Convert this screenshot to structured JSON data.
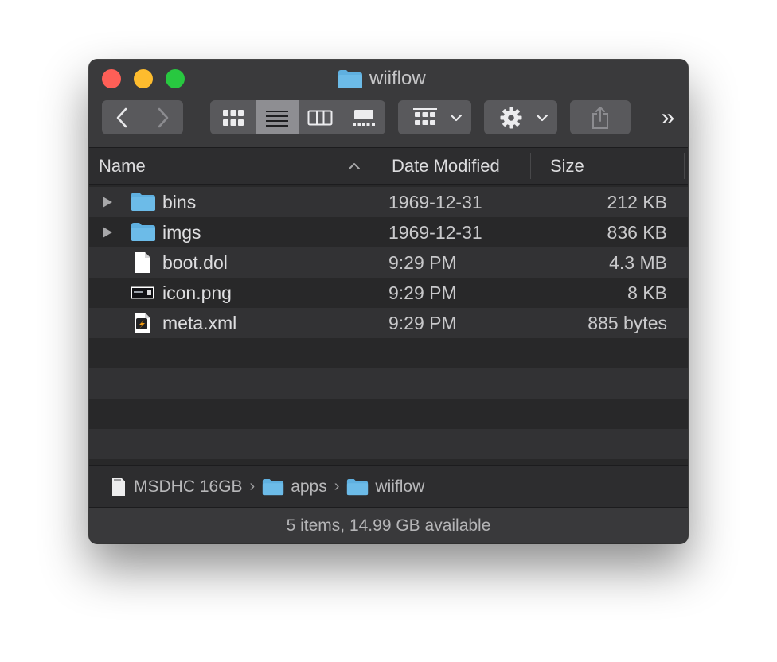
{
  "window": {
    "title": "wiiflow"
  },
  "toolbar": {
    "back": "back-chevron",
    "forward": "forward-chevron",
    "view_modes": [
      "icon-view",
      "list-view",
      "column-view",
      "gallery-view"
    ],
    "active_view": "list-view",
    "group_menu": "group-by-icon",
    "action_menu": "gear-icon",
    "share": "share-icon",
    "overflow": "»"
  },
  "columns": {
    "name": "Name",
    "date": "Date Modified",
    "size": "Size",
    "sort_indicator": "˄"
  },
  "files": [
    {
      "name": "bins",
      "date": "1969-12-31",
      "size": "212 KB",
      "kind": "folder"
    },
    {
      "name": "imgs",
      "date": "1969-12-31",
      "size": "836 KB",
      "kind": "folder"
    },
    {
      "name": "boot.dol",
      "date": "9:29 PM",
      "size": "4.3 MB",
      "kind": "document"
    },
    {
      "name": "icon.png",
      "date": "9:29 PM",
      "size": "8 KB",
      "kind": "image"
    },
    {
      "name": "meta.xml",
      "date": "9:29 PM",
      "size": "885 bytes",
      "kind": "xml"
    }
  ],
  "path": [
    {
      "label": "MSDHC 16GB",
      "icon": "sd-card-icon"
    },
    {
      "label": "apps",
      "icon": "folder-icon"
    },
    {
      "label": "wiiflow",
      "icon": "folder-icon"
    }
  ],
  "path_separator": "›",
  "status": "5 items, 14.99 GB available",
  "colors": {
    "folder": "#5fb0e0",
    "window_bg": "#282829",
    "row_alt": "#323234",
    "selected_segment": "#8e8e92"
  }
}
